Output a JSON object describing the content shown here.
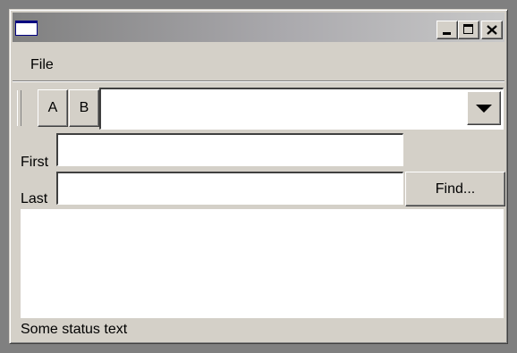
{
  "window": {
    "title": ""
  },
  "menubar": {
    "items": [
      {
        "label": "File"
      }
    ]
  },
  "toolbar": {
    "buttons": [
      {
        "label": "A"
      },
      {
        "label": "B"
      }
    ],
    "combo": {
      "value": ""
    }
  },
  "form": {
    "first_label": "First",
    "first_value": "",
    "last_label": "Last",
    "last_value": "",
    "find_label": "Find..."
  },
  "status": {
    "text": "Some status text"
  },
  "colors": {
    "face": "#d4d0c8",
    "title_gradient_start": "#808080",
    "title_gradient_end": "#c8c8c8",
    "content_bg": "#ffffff"
  }
}
